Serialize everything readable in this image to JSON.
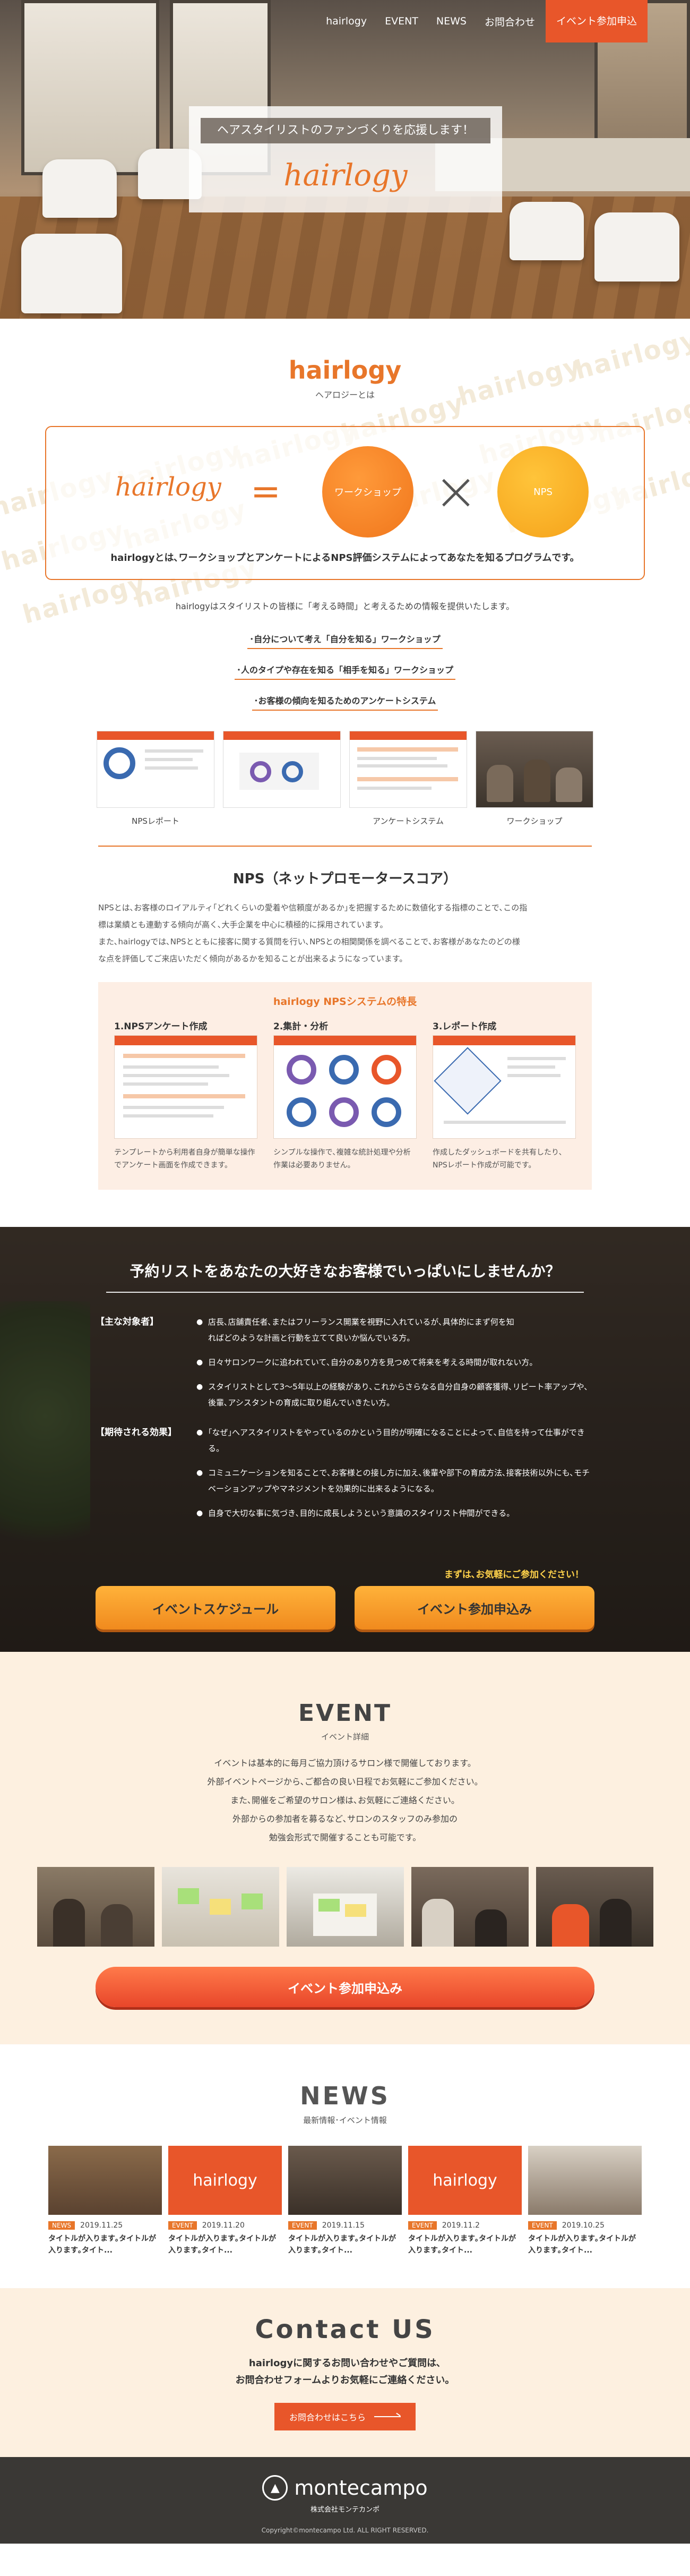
{
  "nav": {
    "items": [
      "hairlogy",
      "EVENT",
      "NEWS",
      "お問合わせ"
    ],
    "cta": "イベント参加申込"
  },
  "hero": {
    "subtitle": "ヘアスタイリストのファンづくりを応援します！",
    "logo": "hairlogy"
  },
  "about": {
    "title_en": "hairlogy",
    "title_jp": "ヘアロジーとは",
    "watermark": "hairlogy",
    "formula": {
      "logo": "hairlogy",
      "eq": "=",
      "workshop": "ワークショップ",
      "times": "×",
      "nps": "NPS",
      "caption": "hairlogyとは､ワークショップとアンケートによるNPS評価システムによってあなたを知るプログラムです。"
    },
    "intro": "hairlogyはスタイリストの皆様に「考える時間」と考えるための情報を提供いたします。",
    "list": [
      "･自分について考え「自分を知る」ワークショップ",
      "･人のタイプや存在を知る「相手を知る」ワークショップ",
      "･お客様の傾向を知るためのアンケートシステム"
    ],
    "thumbs": [
      "NPSレポート",
      "",
      "アンケートシステム",
      "ワークショップ"
    ]
  },
  "nps": {
    "title": "NPS（ネットプロモータースコア）",
    "desc": [
      "NPSとは､お客様のロイアルティ｢どれくらいの愛着や信頼度があるか｣を把握するために数値化する指標のことで､この指",
      "標は業績とも連動する傾向が高く､大手企業を中心に積極的に採用されています。",
      "また､hairlogyでは､NPSとともに接客に関する質問を行い､NPSとの相関関係を調べることで､お客様があなたのどの様",
      "な点を評価してご来店いただく傾向があるかを知ることが出来るようになっています。"
    ],
    "feature_title": "hairlogy NPSシステムの特長",
    "cols": [
      {
        "t": "1.NPSアンケート作成",
        "d": "テンプレートから利用者自身が簡単な操作でアンケート画面を作成できます。"
      },
      {
        "t": "2.集計・分析",
        "d": "シンプルな操作で､複雑な統計処理や分析作業は必要ありません。"
      },
      {
        "t": "3.レポート作成",
        "d": "作成したダッシュボードを共有したり､NPSレポート作成が可能です。"
      }
    ]
  },
  "recruit": {
    "title": "予約リストをあなたの大好きなお客様でいっぱいにしませんか？",
    "target_label": "【主な対象者】",
    "targets": [
      "店長､店舗責任者､またはフリーランス開業を視野に入れているが､具体的にまず何を知",
      "ればどのような計画と行動を立てて良いか悩んでいる方。",
      "日々サロンワークに追われていて､自分のあり方を見つめて将来を考える時間が取れない方。",
      "スタイリストとして3～5年以上の経験があり､これからさらなる自分自身の顧客獲得､リピート率アップや､後輩､アシスタントの育成に取り組んでいきたい方。"
    ],
    "effect_label": "【期待される効果】",
    "effects": [
      "｢なぜ｣へアスタイリストをやっているのかという目的が明確になることによって､自信を持って仕事ができる。",
      "コミュニケーションを知ることで､お客様との接し方に加え､後輩や部下の育成方法､接客技術以外にも､モチベーションアップやマネジメントを効果的に出来るようになる。",
      "自身で大切な事に気づき､目的に成長しようという意識のスタイリスト仲間ができる。"
    ],
    "note": "まずは､お気軽にご参加ください！",
    "btn_schedule": "イベントスケジュール",
    "btn_apply": "イベント参加申込み"
  },
  "event": {
    "title_en": "EVENT",
    "title_jp": "イベント詳細",
    "body": [
      "イベントは基本的に毎月ご協力頂けるサロン様で開催しております。",
      "外部イベントページから､ご都合の良い日程でお気軽にご参加ください。",
      "また､開催をご希望のサロン様は､お気軽にご連絡ください。",
      "外部からの参加者を募るなど､サロンのスタッフのみ参加の",
      "勉強会形式で開催することも可能です。"
    ],
    "btn": "イベント参加申込み"
  },
  "news": {
    "title_en": "NEWS",
    "title_jp": "最新情報･イベント情報",
    "items": [
      {
        "tag": "NEWS",
        "date": "2019.11.25",
        "title": "タイトルが入ります｡タイトルが入ります｡タイト...",
        "img": ""
      },
      {
        "tag": "EVENT",
        "date": "2019.11.20",
        "title": "タイトルが入ります｡タイトルが入ります｡タイト...",
        "img": "hairlogy"
      },
      {
        "tag": "EVENT",
        "date": "2019.11.15",
        "title": "タイトルが入ります｡タイトルが入ります｡タイト...",
        "img": ""
      },
      {
        "tag": "EVENT",
        "date": "2019.11.2",
        "title": "タイトルが入ります｡タイトルが入ります｡タイト...",
        "img": "hairlogy"
      },
      {
        "tag": "EVENT",
        "date": "2019.10.25",
        "title": "タイトルが入ります｡タイトルが入ります｡タイト...",
        "img": ""
      }
    ]
  },
  "contact": {
    "title_en": "Contact US",
    "text1": "hairlogyに関するお問い合わせやご質問は､",
    "text2": "お問合わせフォームよりお気軽にご連絡ください。",
    "btn": "お問合わせはこちら"
  },
  "footer": {
    "brand": "montecampo",
    "company": "株式会社モンテカンポ",
    "copy": "Copyright©montecampo Ltd. ALL RIGHT RESERVED."
  },
  "colors": {
    "accent": "#e8762a",
    "cta": "#e8562a",
    "cream": "#fdf0e0"
  }
}
